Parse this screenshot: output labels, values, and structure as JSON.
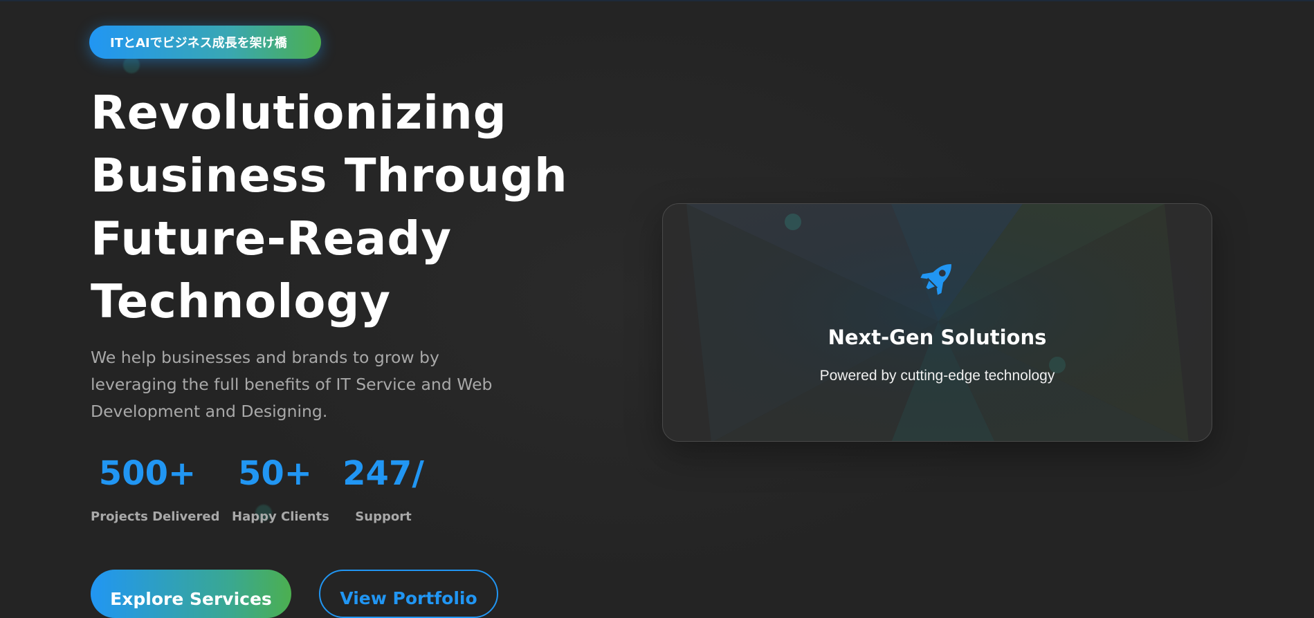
{
  "hero": {
    "badge": "ITとAIでビジネス成長を架け橋",
    "headline_lines": [
      "Revolutionizing",
      "Business Through",
      "Future-Ready",
      "Technology"
    ],
    "description": "We help businesses and brands to grow by leveraging the full benefits of IT Service and Web Development and Designing.",
    "stats": [
      {
        "value": "500+",
        "label": "Projects Delivered"
      },
      {
        "value": "50+",
        "label": "Happy Clients"
      },
      {
        "value": "247/",
        "label": "Support"
      }
    ],
    "buttons": {
      "primary": "Explore Services",
      "secondary": "View Portfolio"
    }
  },
  "feature_card": {
    "icon": "rocket-icon",
    "title": "Next-Gen Solutions",
    "subtitle": "Powered by cutting-edge technology"
  },
  "colors": {
    "background": "#242424",
    "accent_blue": "#2196f3",
    "accent_green": "#4caf50",
    "muted_text": "#a9a9a9"
  }
}
